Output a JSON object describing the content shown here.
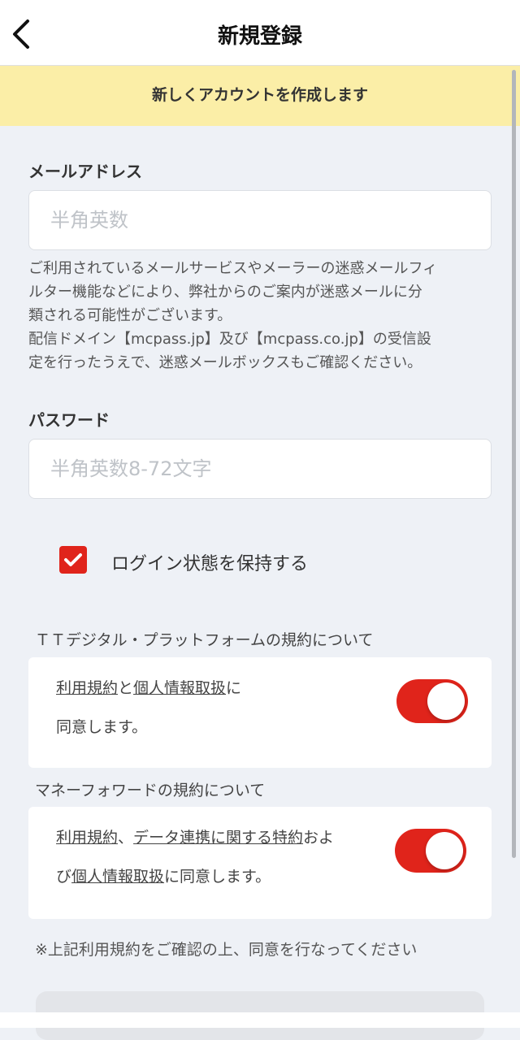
{
  "header": {
    "title": "新規登録",
    "back_icon": "chevron-left-icon"
  },
  "banner": {
    "text": "新しくアカウントを作成します"
  },
  "email": {
    "label": "メールアドレス",
    "placeholder": "半角英数",
    "value": "",
    "note_lines": [
      "ご利用されているメールサービスやメーラーの迷惑メールフィ",
      "ルター機能などにより、弊社からのご案内が迷惑メールに分",
      "類される可能性がございます。",
      "配信ドメイン【mcpass.jp】及び【mcpass.co.jp】の受信設",
      "定を行ったうえで、迷惑メールボックスもご確認ください。"
    ]
  },
  "password": {
    "label": "パスワード",
    "placeholder": "半角英数8-72文字",
    "value": ""
  },
  "remember": {
    "label": "ログイン状態を保持する",
    "checked": true
  },
  "tt_terms": {
    "section_title": "ＴＴデジタル・プラットフォームの規約について",
    "link_terms": "利用規約",
    "and": "と",
    "link_privacy": "個人情報取扱",
    "suffix": "に",
    "line2": "同意します。",
    "toggle_on": true
  },
  "mf_terms": {
    "section_title": "マネーフォワードの規約について",
    "link_terms": "利用規約",
    "comma": "、",
    "link_data": "データ連携に関する特約",
    "oyo": "およ",
    "bi": "び",
    "link_privacy": "個人情報取扱",
    "suffix": "に同意します。",
    "toggle_on": true
  },
  "footnote": "※上記利用規約をご確認の上、同意を行なってください",
  "colors": {
    "accent": "#e0241b",
    "banner": "#fbeea7",
    "background": "#eef1f6"
  }
}
